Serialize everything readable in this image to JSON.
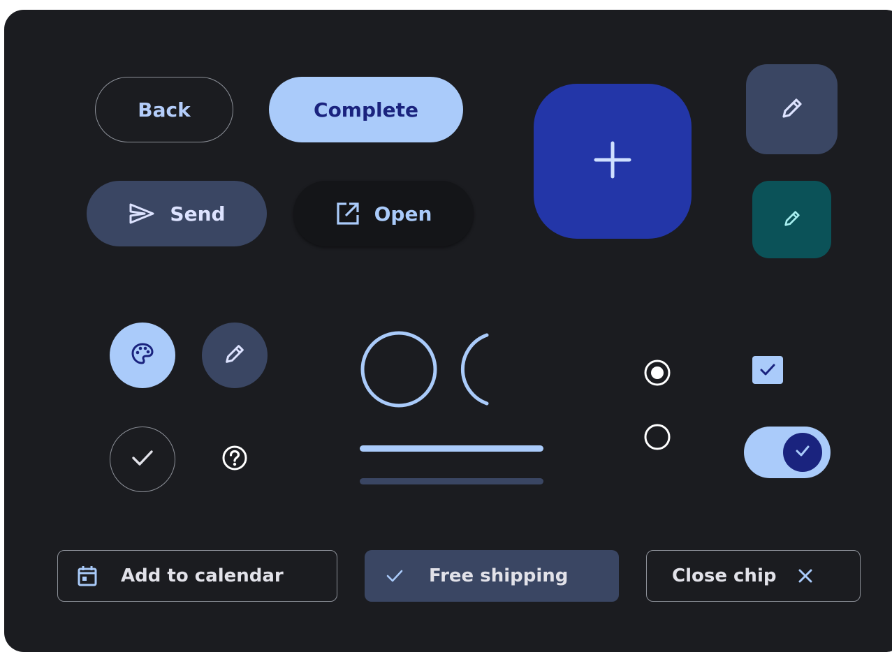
{
  "buttons": {
    "back_label": "Back",
    "complete_label": "Complete",
    "send_label": "Send",
    "open_label": "Open"
  },
  "chips": {
    "add_to_calendar_label": "Add to calendar",
    "free_shipping_label": "Free shipping",
    "close_chip_label": "Close chip"
  },
  "icons": {
    "fab": "plus-icon",
    "small_fab": "pencil-icon",
    "tertiary_fab": "pencil-icon",
    "palette": "palette-icon",
    "edit": "pencil-icon",
    "check": "check-icon",
    "help": "help-icon",
    "send": "send-icon",
    "open": "open-in-new-icon",
    "calendar": "calendar-icon",
    "chip_check": "check-icon",
    "chip_close": "close-icon"
  },
  "progress": {
    "circular_indeterminate": true,
    "circular_arc_fraction": 0.3,
    "linear_primary": 1.0,
    "linear_track": 0.0
  },
  "controls": {
    "radio_selected": true,
    "radio_unselected": false,
    "checkbox_checked": true,
    "switch_on": true
  },
  "colors": {
    "background": "#1b1c20",
    "primary": "#aacbfa",
    "on_primary": "#1a237e",
    "fab_container": "#2336a8",
    "secondary_container": "#3a4663",
    "tertiary_container": "#0b5258",
    "tertiary": "#a8eff0",
    "outline": "#8d9199",
    "on_surface": "#e2e2e9"
  }
}
